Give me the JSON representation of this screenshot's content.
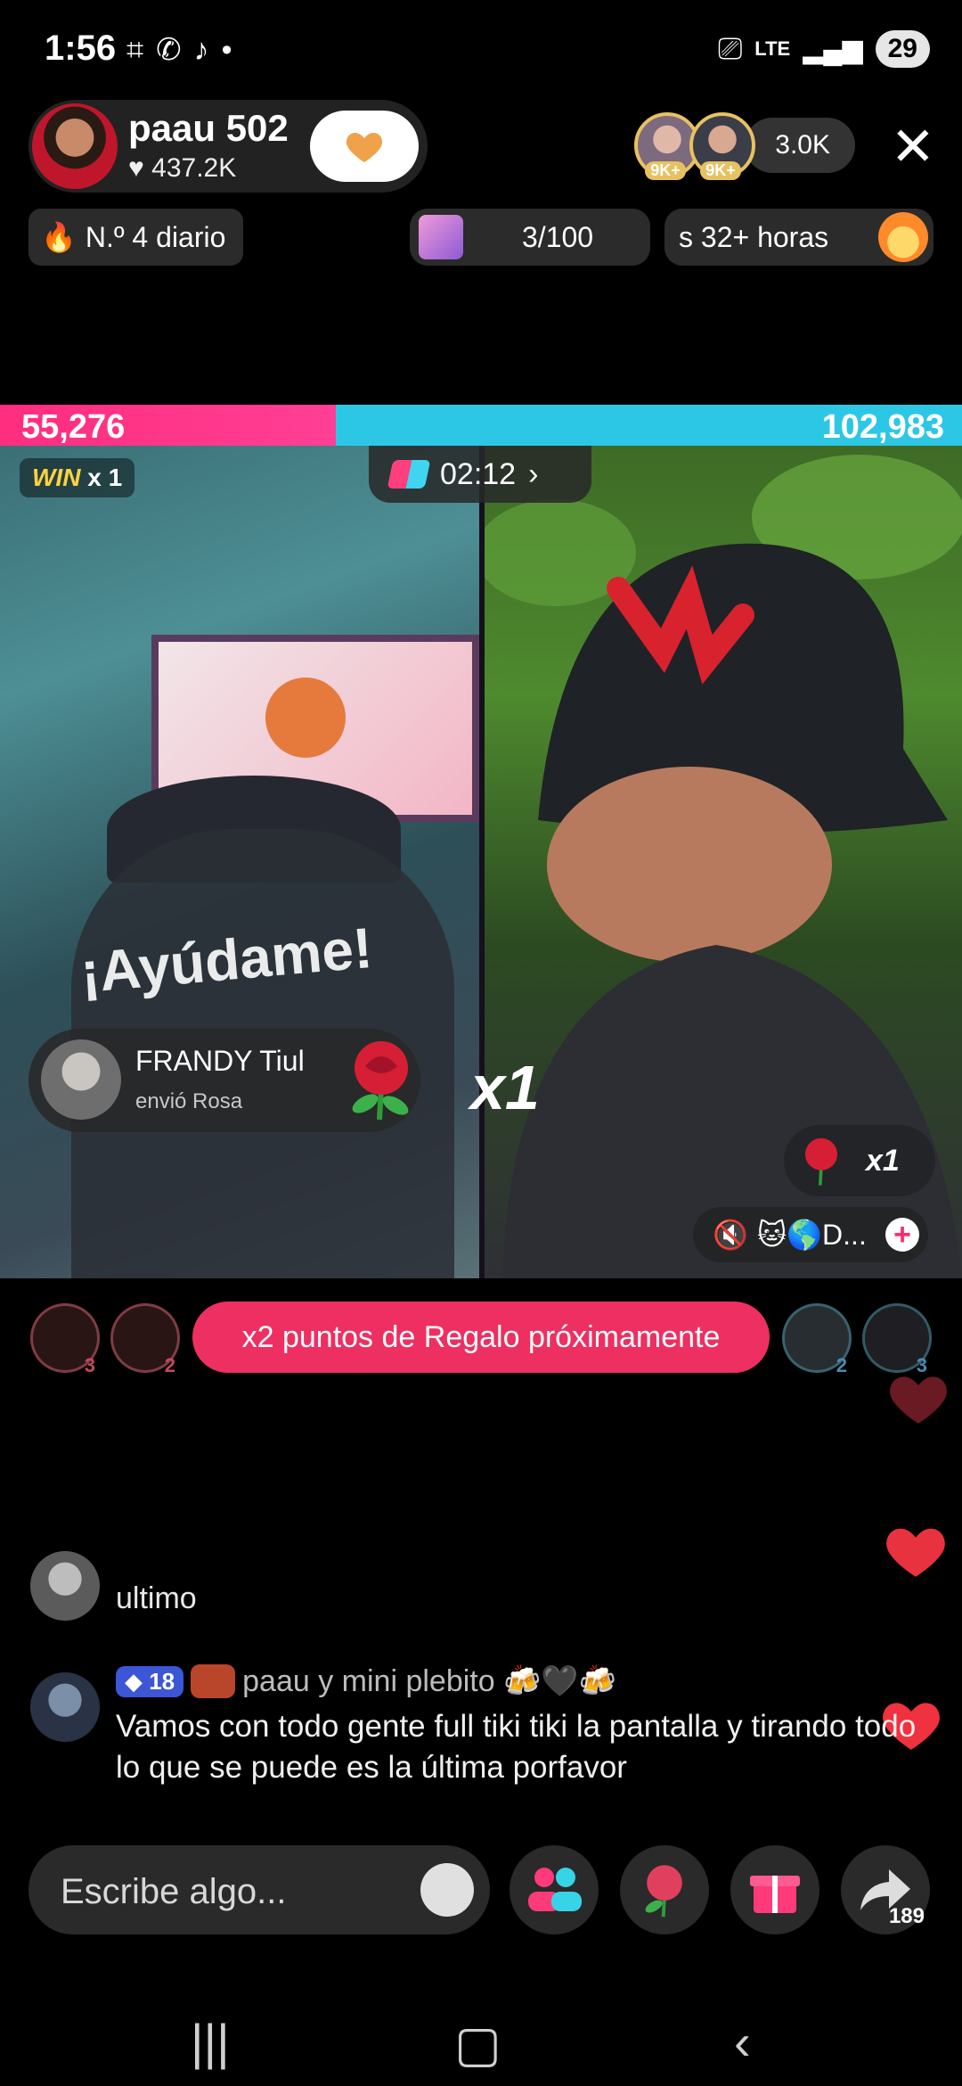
{
  "status_bar": {
    "time": "1:56",
    "battery": "29",
    "network": "LTE"
  },
  "host": {
    "name": "paau 502",
    "likes": "437.2K",
    "follow_badge": "1"
  },
  "viewers": {
    "badges": [
      "9K+",
      "9K+"
    ],
    "count": "3.0K"
  },
  "rank": {
    "label": "N.º 4 diario"
  },
  "goal": {
    "progress": "3/100"
  },
  "streak": {
    "label": "s 32+ horas"
  },
  "battle": {
    "left_score": "55,276",
    "right_score": "102,983",
    "left_share": 0.349,
    "timer": "02:12",
    "win_label": "WIN",
    "win_count": "x 1"
  },
  "overlay_text": "¡Ayúdame!",
  "gift_notification": {
    "sender": "FRANDY Tiul",
    "action": "envió Rosa",
    "multiplier": "x1"
  },
  "right_gift": {
    "multiplier": "x1"
  },
  "opponent": {
    "label": "🐱🌎D..."
  },
  "promo": {
    "text": "x2 puntos de Regalo próximamente"
  },
  "supporters": {
    "left_ranks": [
      "3",
      "2"
    ],
    "right_ranks": [
      "2",
      "3"
    ]
  },
  "chat": [
    {
      "user": "",
      "text": "ultimo"
    },
    {
      "level": "18",
      "user": "paau y mini plebito 🍻🖤🍻",
      "text": "Vamos con todo gente full tiki tiki la pantalla y tirando todo lo que se puede es la última porfavor"
    }
  ],
  "input": {
    "placeholder": "Escribe algo..."
  },
  "share": {
    "count": "189"
  },
  "colors": {
    "accent_pink": "#ee2f62",
    "battle_red": "#ff2d7e",
    "battle_blue": "#2dc7e6",
    "heart": "#e8323f"
  }
}
